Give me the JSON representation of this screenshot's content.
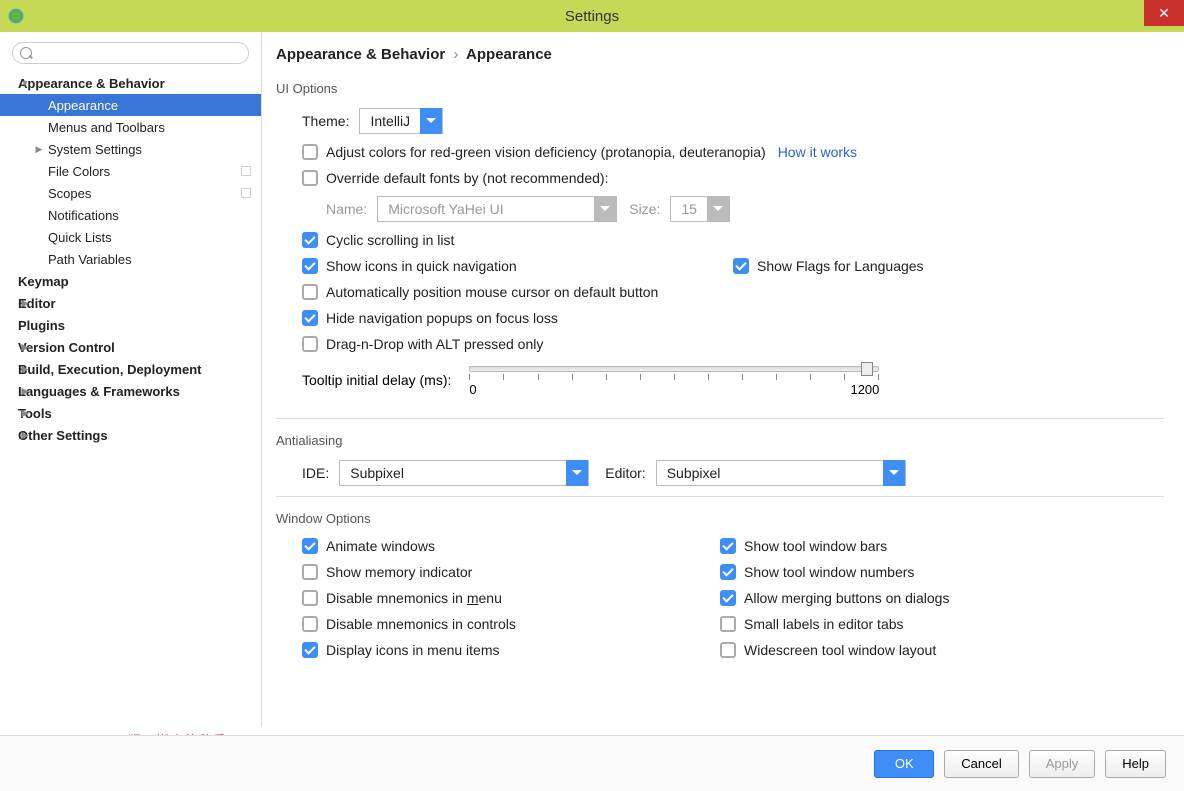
{
  "window": {
    "title": "Settings"
  },
  "sidebar": {
    "search_placeholder": "",
    "items": [
      {
        "label": "Appearance & Behavior",
        "bold": true,
        "expanded": true
      },
      {
        "label": "Appearance",
        "lvl": 1,
        "selected": true
      },
      {
        "label": "Menus and Toolbars",
        "lvl": 1
      },
      {
        "label": "System Settings",
        "lvl": 1,
        "hastoggle": true
      },
      {
        "label": "File Colors",
        "lvl": 1,
        "mini": true
      },
      {
        "label": "Scopes",
        "lvl": 1,
        "mini": true
      },
      {
        "label": "Notifications",
        "lvl": 1
      },
      {
        "label": "Quick Lists",
        "lvl": 1
      },
      {
        "label": "Path Variables",
        "lvl": 1
      },
      {
        "label": "Keymap",
        "bold": true
      },
      {
        "label": "Editor",
        "bold": true,
        "hastoggle": true
      },
      {
        "label": "Plugins",
        "bold": true
      },
      {
        "label": "Version Control",
        "bold": true,
        "hastoggle": true
      },
      {
        "label": "Build, Execution, Deployment",
        "bold": true,
        "hastoggle": true
      },
      {
        "label": "Languages & Frameworks",
        "bold": true,
        "hastoggle": true
      },
      {
        "label": "Tools",
        "bold": true,
        "hastoggle": true
      },
      {
        "label": "Other Settings",
        "bold": true,
        "hastoggle": true
      }
    ]
  },
  "breadcrumb": {
    "part1": "Appearance & Behavior",
    "sep": "›",
    "part2": "Appearance"
  },
  "ui": {
    "heading": "UI Options",
    "theme_label": "Theme:",
    "theme_value": "IntelliJ",
    "adjust_colors": "Adjust colors for red-green vision deficiency (protanopia, deuteranopia)",
    "how_it_works": "How it works",
    "override_fonts": "Override default fonts by (not recommended):",
    "name_label": "Name:",
    "name_value": "Microsoft YaHei UI",
    "size_label": "Size:",
    "size_value": "15",
    "cyclic": "Cyclic scrolling in list",
    "show_icons": "Show icons in quick navigation",
    "show_flags": "Show Flags for Languages",
    "auto_cursor": "Automatically position mouse cursor on default button",
    "hide_popups": "Hide navigation popups on focus loss",
    "drag_alt": "Drag-n-Drop with ALT pressed only",
    "tooltip_label": "Tooltip initial delay (ms):",
    "tooltip_min": "0",
    "tooltip_max": "1200"
  },
  "aa": {
    "heading": "Antialiasing",
    "ide_label": "IDE:",
    "ide_value": "Subpixel",
    "editor_label": "Editor:",
    "editor_value": "Subpixel"
  },
  "win": {
    "heading": "Window Options",
    "animate": "Animate windows",
    "show_bars": "Show tool window bars",
    "memory": "Show memory indicator",
    "show_numbers": "Show tool window numbers",
    "dis_menu": "Disable mnemonics in menu",
    "merge_dialogs": "Allow merging buttons on dialogs",
    "dis_controls": "Disable mnemonics in controls",
    "small_labels": "Small labels in editor tabs",
    "display_icons": "Display icons in menu items",
    "widescreen": "Widescreen tool window layout"
  },
  "footer": {
    "ok": "OK",
    "cancel": "Cancel",
    "apply": "Apply",
    "help": "Help"
  },
  "watermark": "猴子搬来的救兵WooYun http://blog.csdn.net/mynameishuangshuai"
}
